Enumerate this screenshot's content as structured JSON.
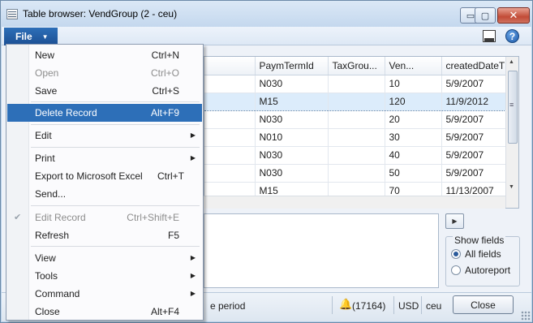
{
  "window": {
    "title": "Table browser: VendGroup (2 - ceu)",
    "min_glyph": "▭",
    "max_glyph": "▢",
    "close_glyph": "✕"
  },
  "menubar": {
    "file_label": "File",
    "file_chevron": "▼",
    "help_glyph": "?"
  },
  "file_menu": {
    "items": [
      {
        "label": "New",
        "shortcut": "Ctrl+N"
      },
      {
        "label": "Open",
        "shortcut": "Ctrl+O",
        "disabled": true
      },
      {
        "label": "Save",
        "shortcut": "Ctrl+S"
      },
      {
        "label": "Delete Record",
        "shortcut": "Alt+F9",
        "highlighted": true
      },
      {
        "label": "Edit",
        "submenu": true
      },
      {
        "label": "Print",
        "submenu": true
      },
      {
        "label": "Export to Microsoft Excel",
        "shortcut": "Ctrl+T"
      },
      {
        "label": "Send..."
      },
      {
        "label": "Edit Record",
        "shortcut": "Ctrl+Shift+E",
        "disabled": true,
        "checked": true
      },
      {
        "label": "Refresh",
        "shortcut": "F5"
      },
      {
        "label": "View",
        "submenu": true
      },
      {
        "label": "Tools",
        "submenu": true
      },
      {
        "label": "Command",
        "submenu": true
      },
      {
        "label": "Close",
        "shortcut": "Alt+F4"
      }
    ],
    "submenu_glyph": "▶",
    "check_glyph": "✔"
  },
  "grid": {
    "columns": [
      "PaymTermId",
      "TaxGrou...",
      "Ven...",
      "createdDateT"
    ],
    "rows": [
      [
        "N030",
        "",
        "10",
        "5/9/2007"
      ],
      [
        "M15",
        "",
        "120",
        "11/9/2012"
      ],
      [
        "N030",
        "",
        "20",
        "5/9/2007"
      ],
      [
        "N010",
        "",
        "30",
        "5/9/2007"
      ],
      [
        "N030",
        "",
        "40",
        "5/9/2007"
      ],
      [
        "N030",
        "",
        "50",
        "5/9/2007"
      ],
      [
        "M15",
        "",
        "70",
        "11/13/2007"
      ]
    ],
    "selected_row": 1,
    "scroll_up": "▲",
    "scroll_down": "▼",
    "scroll_grip": "≡"
  },
  "panel": {
    "play_glyph": "▶",
    "show_fields_label": "Show fields",
    "option_all": "All fields",
    "option_auto": "Autoreport",
    "selected_option": "All fields"
  },
  "status": {
    "period_text": "e period",
    "notifications": "(17164)",
    "currency": "USD",
    "company": "ceu",
    "close_label": "Close",
    "bell_glyph": "🔔"
  }
}
